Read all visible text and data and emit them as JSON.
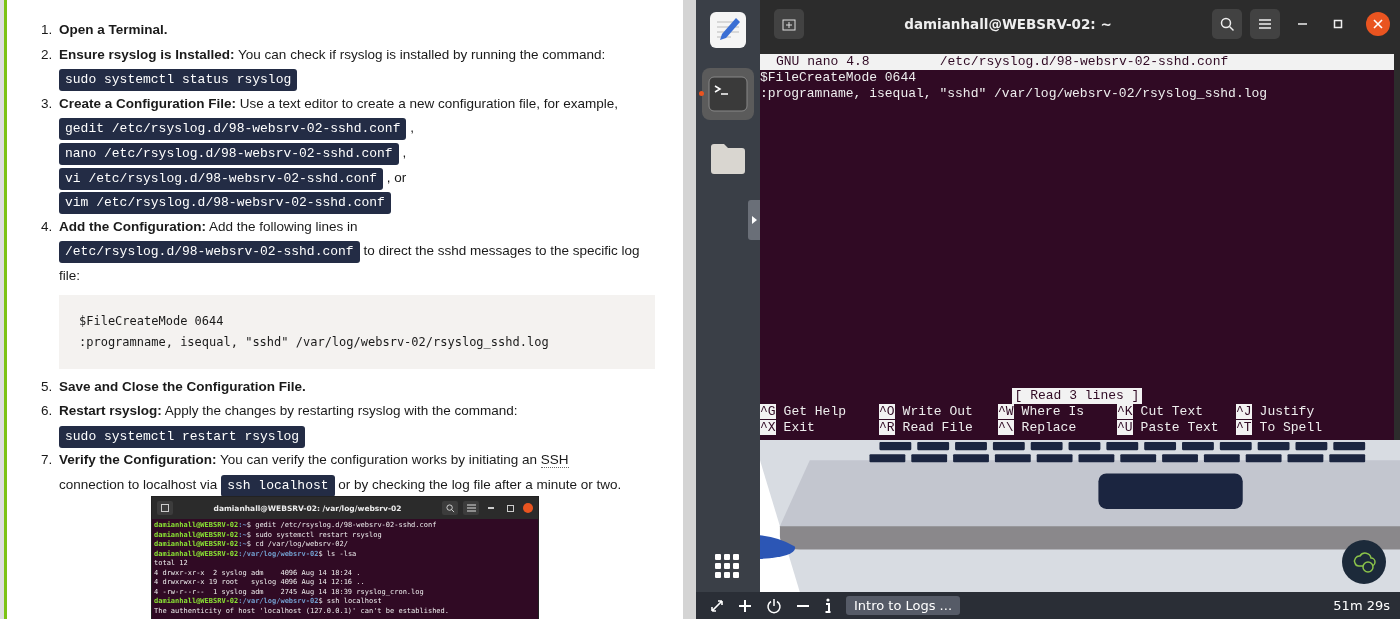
{
  "article": {
    "steps": [
      {
        "number": "1.",
        "title": "Open a Terminal."
      },
      {
        "number": "2.",
        "title": "Ensure rsyslog is Installed:",
        "segments": [
          {
            "kind": "text",
            "text": "You can check if rsyslog is installed by running the command:"
          },
          {
            "kind": "break"
          },
          {
            "kind": "code",
            "text": "sudo systemctl status rsyslog"
          }
        ]
      },
      {
        "number": "3.",
        "title": "Create a Configuration File:",
        "segments": [
          {
            "kind": "text",
            "text": "Use a text editor to create a new configuration file, for example,"
          },
          {
            "kind": "break"
          },
          {
            "kind": "code",
            "text": "gedit /etc/rsyslog.d/98-websrv-02-sshd.conf"
          },
          {
            "kind": "text",
            "text": ","
          },
          {
            "kind": "break"
          },
          {
            "kind": "code",
            "text": "nano /etc/rsyslog.d/98-websrv-02-sshd.conf"
          },
          {
            "kind": "text",
            "text": ","
          },
          {
            "kind": "break"
          },
          {
            "kind": "code",
            "text": "vi /etc/rsyslog.d/98-websrv-02-sshd.conf"
          },
          {
            "kind": "text",
            "text": ", or"
          },
          {
            "kind": "break"
          },
          {
            "kind": "code",
            "text": "vim /etc/rsyslog.d/98-websrv-02-sshd.conf"
          }
        ]
      },
      {
        "number": "4.",
        "title": "Add the Configuration:",
        "segments": [
          {
            "kind": "text",
            "text": "Add the following lines in"
          },
          {
            "kind": "break"
          },
          {
            "kind": "code",
            "text": "/etc/rsyslog.d/98-websrv-02-sshd.conf"
          },
          {
            "kind": "text",
            "text": "to direct the sshd messages to the specific log"
          },
          {
            "kind": "break"
          },
          {
            "kind": "text",
            "text": "file:"
          }
        ],
        "code_block": [
          "$FileCreateMode 0644",
          ":programname, isequal, \"sshd\" /var/log/websrv-02/rsyslog_sshd.log"
        ]
      },
      {
        "number": "5.",
        "title": "Save and Close the Configuration File."
      },
      {
        "number": "6.",
        "title": "Restart rsyslog:",
        "segments": [
          {
            "kind": "text",
            "text": "Apply the changes by restarting rsyslog with the command:"
          },
          {
            "kind": "break"
          },
          {
            "kind": "code",
            "text": "sudo systemctl restart rsyslog"
          }
        ]
      },
      {
        "number": "7.",
        "title": "Verify the Configuration:",
        "segments": [
          {
            "kind": "text",
            "text": "You can verify the configuration works by initiating an"
          },
          {
            "kind": "abbr",
            "text": "SSH"
          },
          {
            "kind": "break"
          },
          {
            "kind": "text",
            "text": "connection to localhost via"
          },
          {
            "kind": "code",
            "text": "ssh localhost"
          },
          {
            "kind": "text",
            "text": "or by checking the log file after a minute or two."
          }
        ]
      }
    ],
    "screenshot": {
      "title": "damianhall@WEBSRV-02: /var/log/websrv-02",
      "lines": [
        {
          "kind": "prompt",
          "user": "damianhall@WEBSRV-02",
          "path": ":~",
          "command": "$ gedit /etc/rsyslog.d/98-websrv-02-sshd.conf"
        },
        {
          "kind": "prompt",
          "user": "damianhall@WEBSRV-02",
          "path": ":~",
          "command": "$ sudo systemctl restart rsyslog"
        },
        {
          "kind": "prompt",
          "user": "damianhall@WEBSRV-02",
          "path": ":~",
          "command": "$ cd /var/log/websrv-02/"
        },
        {
          "kind": "prompt",
          "user": "damianhall@WEBSRV-02",
          "path": ":/var/log/websrv-02",
          "command": "$ ls -lsa"
        },
        {
          "kind": "output",
          "text": "total 12"
        },
        {
          "kind": "output",
          "text": "4 drwxr-xr-x  2 syslog adm    4096 Aug 14 18:24 ."
        },
        {
          "kind": "output",
          "text": "4 drwxrwxr-x 19 root   syslog 4096 Aug 14 12:16 .."
        },
        {
          "kind": "output",
          "text": "4 -rw-r--r--  1 syslog adm    2745 Aug 14 18:39 rsyslog_cron.log"
        },
        {
          "kind": "prompt",
          "user": "damianhall@WEBSRV-02",
          "path": ":/var/log/websrv-02",
          "command": "$ ssh localhost"
        },
        {
          "kind": "output",
          "text": "The authenticity of host 'localhost (127.0.0.1)' can't be established."
        }
      ]
    }
  },
  "dock": {
    "items": [
      {
        "kind": "editor",
        "selected": false
      },
      {
        "kind": "terminal",
        "selected": true
      },
      {
        "kind": "files",
        "selected": false
      }
    ]
  },
  "terminal": {
    "title": "damianhall@WEBSRV-02: ~",
    "nano": {
      "version": "GNU nano 4.8",
      "file": "/etc/rsyslog.d/98-websrv-02-sshd.conf",
      "lines": [
        "$FileCreateMode 0644",
        ":programname, isequal, \"sshd\" /var/log/websrv-02/rsyslog_sshd.log"
      ],
      "status": "[ Read 3 lines ]",
      "shortcuts": [
        {
          "key": "^G",
          "label": "Get Help"
        },
        {
          "key": "^O",
          "label": "Write Out"
        },
        {
          "key": "^W",
          "label": "Where Is"
        },
        {
          "key": "^K",
          "label": "Cut Text"
        },
        {
          "key": "^J",
          "label": "Justify"
        },
        {
          "key": "^X",
          "label": "Exit"
        },
        {
          "key": "^R",
          "label": "Read File"
        },
        {
          "key": "^\\",
          "label": "Replace"
        },
        {
          "key": "^U",
          "label": "Paste Text"
        },
        {
          "key": "^T",
          "label": "To Spell"
        }
      ]
    }
  },
  "toolbar": {
    "session": "Intro to Logs ...",
    "timer": "51m 29s"
  }
}
